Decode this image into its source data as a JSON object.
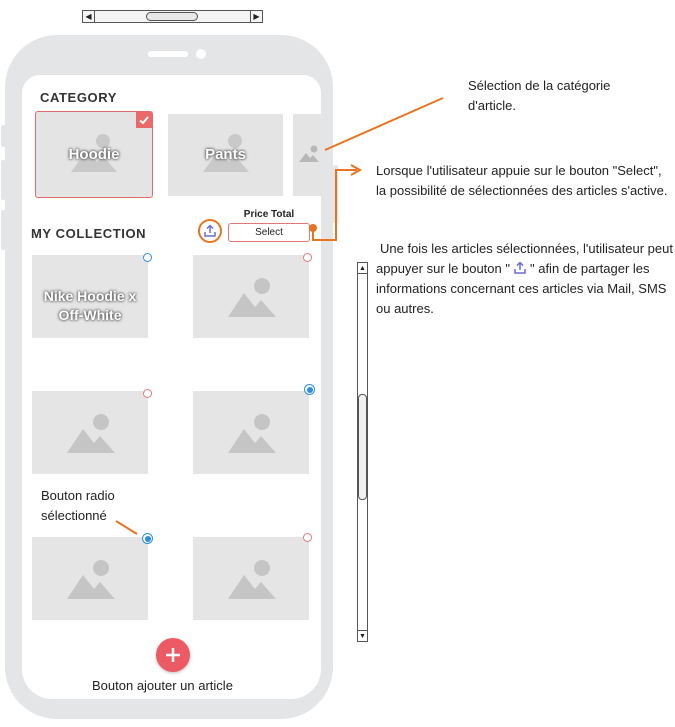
{
  "phone": {
    "category_heading": "CATEGORY",
    "collection_heading": "MY COLLECTION",
    "categories": [
      {
        "label": "Hoodie",
        "selected": true
      },
      {
        "label": "Pants",
        "selected": false
      },
      {
        "label": "",
        "selected": false
      }
    ],
    "price_total_label": "Price Total",
    "select_label": "Select",
    "items": [
      {
        "label": "Nike Hoodie x Off-White",
        "radio": "unselected-blue"
      },
      {
        "label": "",
        "radio": "unselected"
      },
      {
        "label": "",
        "radio": "unselected"
      },
      {
        "label": "",
        "radio": "selected"
      },
      {
        "label": "",
        "radio": "selected"
      },
      {
        "label": "",
        "radio": "unselected"
      }
    ]
  },
  "annotations": {
    "category": "Sélection de la catégorie d'article.",
    "select": "Lorsque l'utilisateur appuie sur le bouton \"Select\", la possibilité de sélectionnées des articles s'active.",
    "share_before": "Une fois les articles sélectionnées, l'utilisateur peut appuyer sur le bouton \"",
    "share_after": "\" afin de partager les informations concernant ces articles via Mail, SMS ou autres.",
    "radio": "Bouton radio sélectionné",
    "add": "Bouton ajouter un article"
  },
  "colors": {
    "accent_orange": "#e8741f",
    "selection_red": "#e06b6b",
    "radio_blue": "#2e8de0",
    "fab_red": "#ec5a64",
    "placeholder_gray": "#e5e5e5",
    "share_icon_blue": "#6b6bd8"
  },
  "icons": [
    "scroll-left-arrow-icon",
    "scroll-right-arrow-icon",
    "checkmark-icon",
    "image-placeholder-icon",
    "share-icon",
    "plus-icon",
    "scroll-up-arrow-icon",
    "scroll-down-arrow-icon"
  ]
}
